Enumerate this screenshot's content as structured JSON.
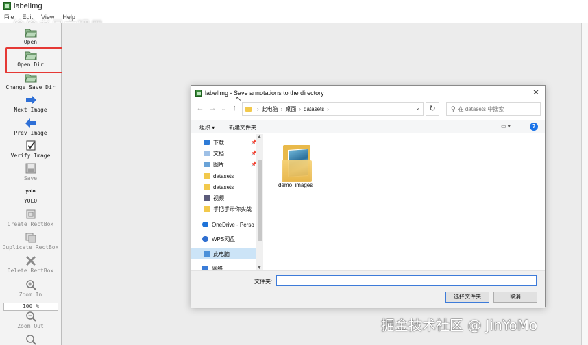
{
  "window": {
    "title": "labelImg"
  },
  "menu": [
    "File",
    "Edit",
    "View",
    "Help"
  ],
  "watermark_top": "偷偷老足文理用",
  "toolbar": {
    "open": "Open",
    "open_dir": "Open Dir",
    "change_save_dir": "Change Save Dir",
    "next_image": "Next Image",
    "prev_image": "Prev Image",
    "verify_image": "Verify Image",
    "save": "Save",
    "yolo_icon_text": "yolo",
    "yolo": "YOLO",
    "create_rectbox": "Create RectBox",
    "duplicate_rectbox": "Duplicate RectBox",
    "delete_rectbox": "Delete RectBox",
    "zoom_in": "Zoom In",
    "zoom_level": "100 %",
    "zoom_out": "Zoom Out"
  },
  "dialog": {
    "title": "labelImg - Save annotations to the directory",
    "breadcrumb": [
      "此电脑",
      "桌面",
      "datasets"
    ],
    "search_placeholder": "在 datasets 中搜索",
    "organize": "组织 ▾",
    "new_folder": "新建文件夹",
    "nav_items": [
      {
        "label": "下载",
        "pinned": true
      },
      {
        "label": "文档",
        "pinned": true
      },
      {
        "label": "图片",
        "pinned": true
      },
      {
        "label": "datasets",
        "pinned": false
      },
      {
        "label": "datasets",
        "pinned": false
      },
      {
        "label": "视频",
        "pinned": false
      },
      {
        "label": "手把手带你实战",
        "pinned": false
      },
      {
        "label": "OneDrive - Perso",
        "pinned": false
      },
      {
        "label": "WPS网盘",
        "pinned": false
      },
      {
        "label": "此电脑",
        "pinned": false
      },
      {
        "label": "网络",
        "pinned": false
      }
    ],
    "folder_name": "demo_images",
    "filename_label": "文件夹:",
    "filename_value": "",
    "select_button": "选择文件夹",
    "cancel_button": "取消"
  },
  "watermark_bottom": "掘金技术社区 @ JinYoMo",
  "colors": {
    "highlight": "#e53935",
    "selection": "#cce4f7",
    "accent": "#3d7bd9"
  }
}
